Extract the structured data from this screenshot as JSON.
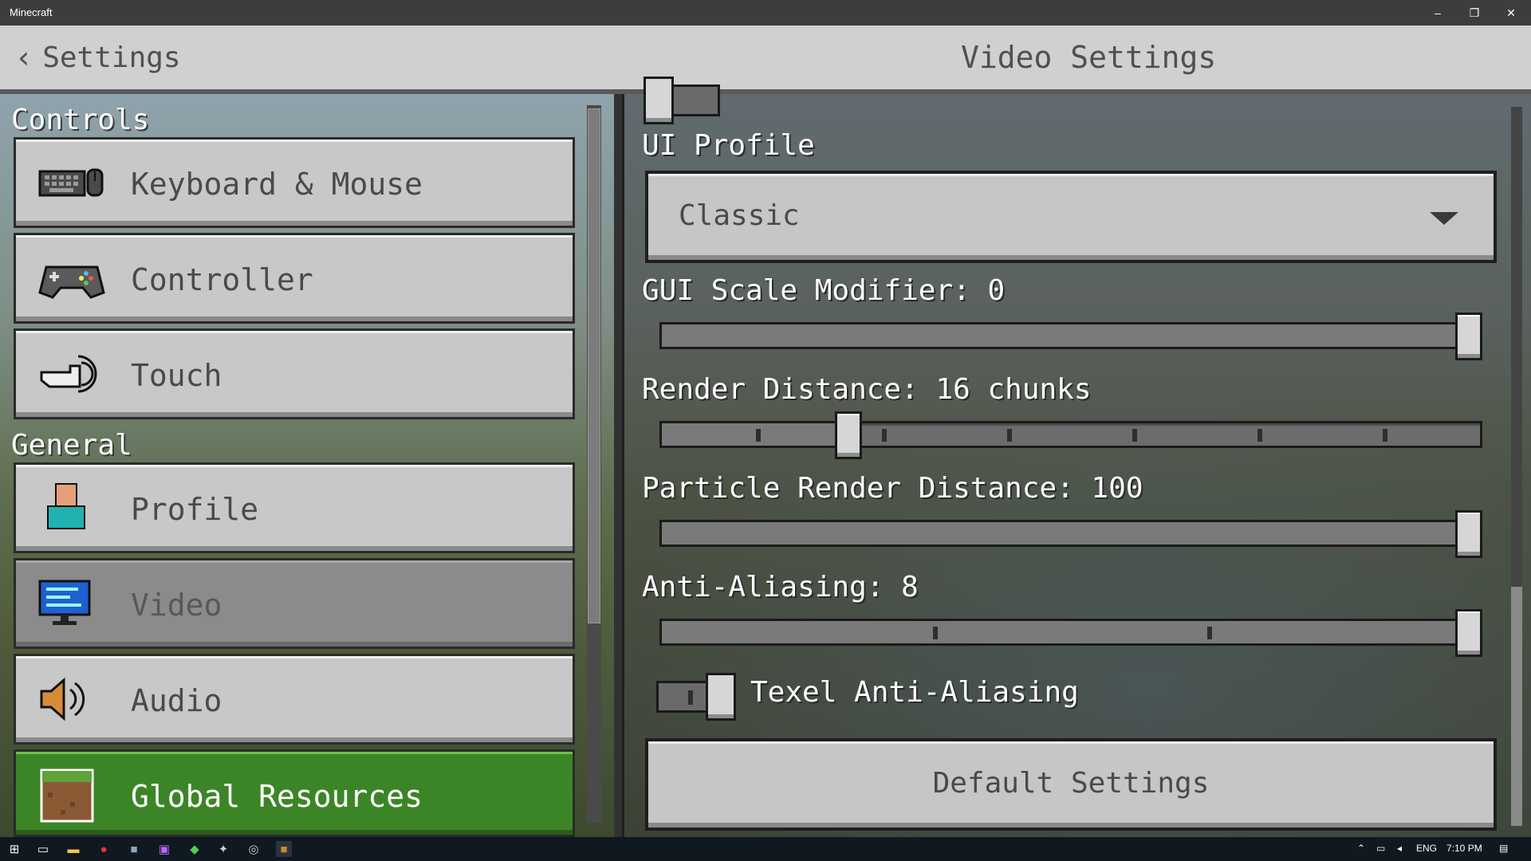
{
  "window": {
    "title": "Minecraft",
    "minimize": "–",
    "restore": "❐",
    "close": "✕"
  },
  "header": {
    "back_label": "Settings",
    "back_chevron": "‹",
    "page_title": "Video Settings"
  },
  "sidebar": {
    "sections": [
      {
        "title": "Controls"
      },
      {
        "title": "General"
      }
    ],
    "items": [
      {
        "label": "Keyboard & Mouse",
        "icon": "keyboard-mouse-icon"
      },
      {
        "label": "Controller",
        "icon": "controller-icon"
      },
      {
        "label": "Touch",
        "icon": "touch-icon"
      },
      {
        "label": "Profile",
        "icon": "profile-icon"
      },
      {
        "label": "Video",
        "icon": "monitor-icon",
        "selected": true
      },
      {
        "label": "Audio",
        "icon": "speaker-icon"
      },
      {
        "label": "Global Resources",
        "icon": "grass-block-icon",
        "highlight": true
      }
    ]
  },
  "video": {
    "ui_profile": {
      "label": "UI Profile",
      "value": "Classic"
    },
    "gui_scale": {
      "label": "GUI Scale Modifier: 0",
      "level": 1.0
    },
    "render_distance": {
      "label": "Render Distance: 16 chunks",
      "level": 0.22
    },
    "particle_render": {
      "label": "Particle Render Distance: 100",
      "level": 1.0
    },
    "anti_aliasing": {
      "label": "Anti-Aliasing: 8",
      "level": 1.0
    },
    "texel_aa": {
      "label": "Texel Anti-Aliasing",
      "on": true
    },
    "default_button": "Default Settings"
  },
  "taskbar": {
    "language": "ENG",
    "time": "7:10 PM"
  },
  "colors": {
    "accent_green": "#3c8527",
    "button_gray": "#c8c8c8",
    "title_bar": "#3d3d3d"
  }
}
